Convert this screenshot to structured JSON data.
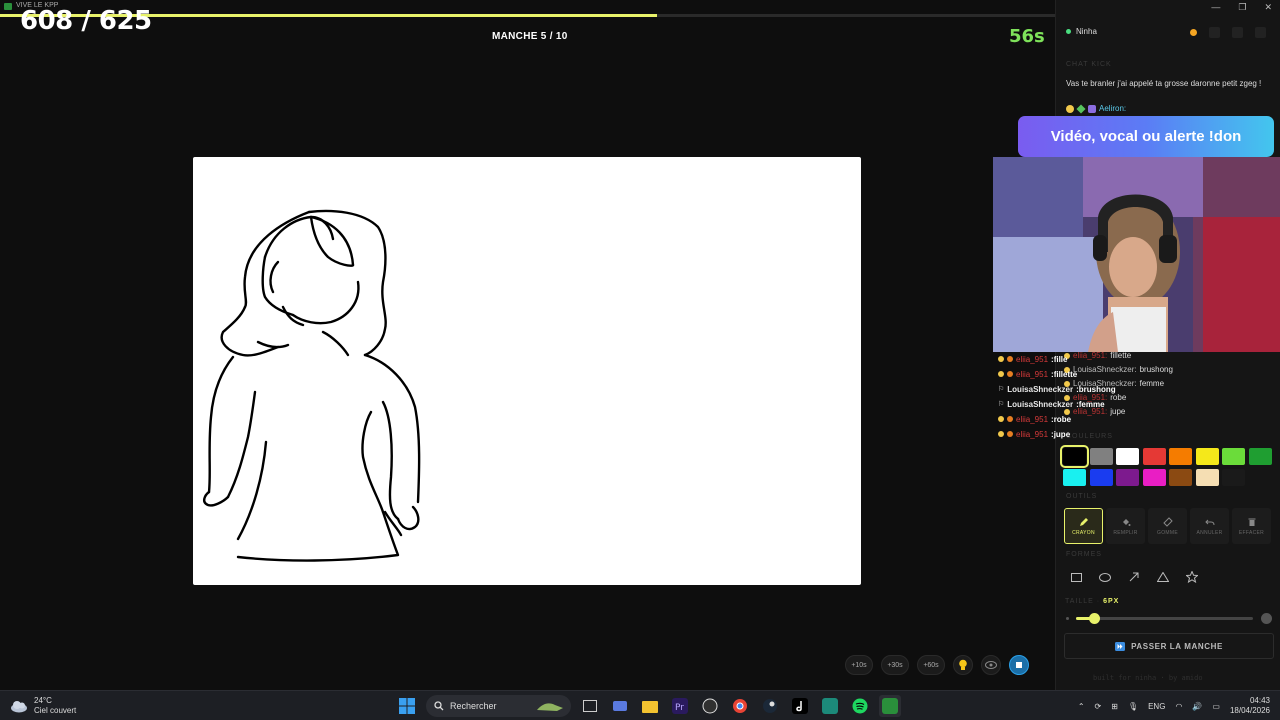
{
  "titlebar": {
    "app_title": "VIVE LE KPP",
    "progress_pct": 62.3
  },
  "game": {
    "score": "608 / 625",
    "round": "MANCHE 5 / 10",
    "timer": "56s",
    "time_buttons": [
      "+10s",
      "+30s",
      "+60s"
    ]
  },
  "panel": {
    "username": "Ninha",
    "chat_section": "CHAT KICK",
    "chat_message": "Vas te branler j'ai appelé ta grosse daronne petit zgeg !",
    "chat_author": "Aeliron:",
    "banner": "Vidéo, vocal ou alerte !don",
    "guesses": [
      {
        "user": "eliia_951",
        "word": ":fille"
      },
      {
        "user": "eliia_951",
        "word": ":fillette"
      },
      {
        "user": "LouisaShneckzer",
        "word": ":brushong"
      },
      {
        "user": "LouisaShneckzer",
        "word": ":femme"
      },
      {
        "user": "eliia_951",
        "word": ":robe"
      },
      {
        "user": "eliia_951",
        "word": ":jupe"
      }
    ],
    "ghost_guesses": [
      {
        "user": "eliia_951:",
        "word": "fillette"
      },
      {
        "user": "LouisaShneckzer:",
        "word": "brushong"
      },
      {
        "user": "LouisaShneckzer:",
        "word": "femme"
      },
      {
        "user": "eliia_951:",
        "word": "robe"
      },
      {
        "user": "eliia_951:",
        "word": "jupe"
      }
    ],
    "colors_label": "COULEURS",
    "colors": [
      "#000000",
      "#808080",
      "#ffffff",
      "#e53935",
      "#f57c00",
      "#f5e81a",
      "#6bdc3a",
      "#1f9e31",
      "#19f0f0",
      "#1a3cf0",
      "#7d1a8e",
      "#e91ec4",
      "#8b4a12",
      "#f5deb3",
      "#1a1a1a"
    ],
    "tools_label": "OUTILS",
    "tools": [
      {
        "label": "CRAYON",
        "icon": "pencil-icon"
      },
      {
        "label": "REMPLIR",
        "icon": "bucket-icon"
      },
      {
        "label": "GOMME",
        "icon": "eraser-icon"
      },
      {
        "label": "ANNULER",
        "icon": "undo-icon"
      },
      {
        "label": "EFFACER",
        "icon": "trash-icon"
      }
    ],
    "shapes_label": "FORMES",
    "shapes": [
      "rectangle-icon",
      "ellipse-icon",
      "arrow-icon",
      "triangle-icon",
      "star-icon"
    ],
    "size_label": "TAILLE",
    "size_value": "6PX",
    "size_fraction": 0.1,
    "skip_label": "PASSER LA MANCHE",
    "footer": "built for ninha · by amido"
  },
  "taskbar": {
    "temp": "24°C",
    "weather": "Ciel couvert",
    "search_placeholder": "Rechercher",
    "lang": "ENG",
    "time": "04:43",
    "date": "18/04/2026"
  }
}
